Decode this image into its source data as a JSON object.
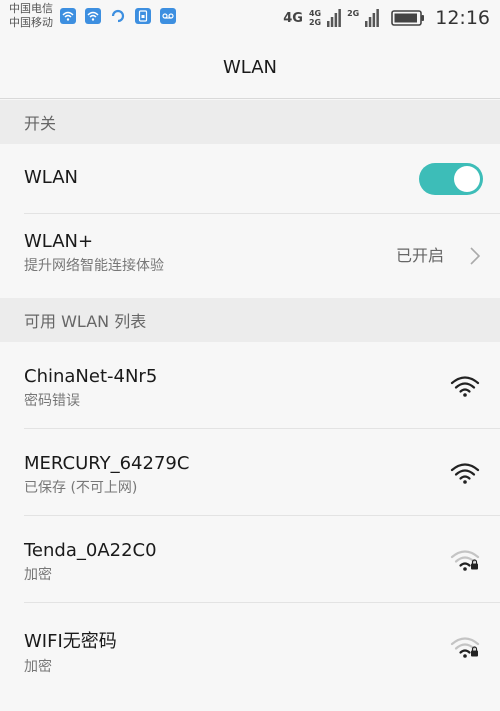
{
  "status_bar": {
    "carrier_1": "中国电信",
    "carrier_2": "中国移动",
    "net_type": "4G",
    "net_top": "4G",
    "net_bottom": "2G",
    "net_extra": "2G",
    "time": "12:16",
    "battery_level": 0.9
  },
  "header": {
    "title": "WLAN"
  },
  "sections": {
    "switch_header": "开关",
    "available_header": "可用 WLAN 列表"
  },
  "wlan_toggle": {
    "label": "WLAN",
    "on": true
  },
  "wlan_plus": {
    "label": "WLAN+",
    "subtitle": "提升网络智能连接体验",
    "value": "已开启"
  },
  "networks": [
    {
      "ssid": "ChinaNet-4Nr5",
      "status": "密码错误",
      "signal": "strong",
      "locked": false
    },
    {
      "ssid": "MERCURY_64279C",
      "status": "已保存 (不可上网)",
      "signal": "strong",
      "locked": false
    },
    {
      "ssid": "Tenda_0A22C0",
      "status": "加密",
      "signal": "weak",
      "locked": true
    },
    {
      "ssid": "WIFI无密码",
      "status": "加密",
      "signal": "weak",
      "locked": true
    }
  ],
  "colors": {
    "accent": "#3dbdb8",
    "background": "#f7f7f7",
    "section_bg": "#ececec"
  }
}
